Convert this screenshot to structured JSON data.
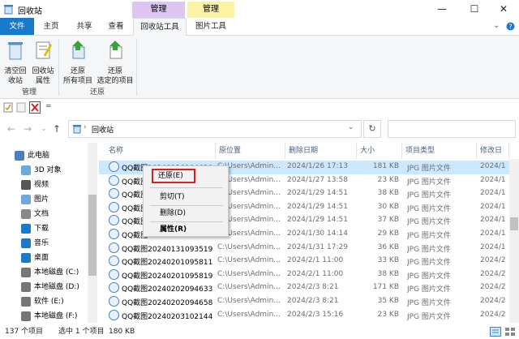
{
  "window": {
    "title": "回收站",
    "minimize": "—",
    "maximize": "☐",
    "close": "✕"
  },
  "contextual_tabs": [
    {
      "label": "管理",
      "color": "#ddc6f2"
    },
    {
      "label": "管理",
      "color": "#fdf3a4"
    }
  ],
  "tabs": {
    "file": "文件",
    "home": "主页",
    "share": "共享",
    "view": "查看",
    "recycle_tools": "回收站工具",
    "picture_tools": "图片工具"
  },
  "ribbon": {
    "empty_bin": [
      "清空回",
      "收站"
    ],
    "bin_props": [
      "回收站",
      "属性"
    ],
    "restore_all": [
      "还原",
      "所有项目"
    ],
    "restore_sel": [
      "还原",
      "选定的项目"
    ],
    "group_manage": "管理",
    "group_restore": "还原"
  },
  "address": {
    "path": "回收站",
    "dropdown": "⌄",
    "refresh": "↻"
  },
  "nav": {
    "back": "←",
    "forward": "→",
    "recent": "⌄",
    "up": "↑"
  },
  "navpane": [
    {
      "label": "此电脑",
      "icon": "computer-icon"
    },
    {
      "label": "3D 对象",
      "icon": "cube-icon"
    },
    {
      "label": "视频",
      "icon": "video-icon"
    },
    {
      "label": "图片",
      "icon": "picture-icon"
    },
    {
      "label": "文档",
      "icon": "document-icon"
    },
    {
      "label": "下载",
      "icon": "download-icon"
    },
    {
      "label": "音乐",
      "icon": "music-icon"
    },
    {
      "label": "桌面",
      "icon": "desktop-icon"
    },
    {
      "label": "本地磁盘 (C:)",
      "icon": "drive-icon"
    },
    {
      "label": "本地磁盘 (D:)",
      "icon": "drive-icon"
    },
    {
      "label": "软件 (E:)",
      "icon": "drive-icon"
    },
    {
      "label": "本地磁盘 (F:)",
      "icon": "drive-icon"
    }
  ],
  "columns": {
    "name": "名称",
    "path": "原位置",
    "deleted": "删除日期",
    "size": "大小",
    "type": "项目类型",
    "modified": "修改日"
  },
  "rows": [
    {
      "name": "QQ截图20240126104630",
      "path": "C:\\Users\\Admin...",
      "date": "2024/1/26 17:13",
      "size": "181 KB",
      "type": "JPG 图片文件",
      "mod": "2024/1"
    },
    {
      "name": "QQ截图",
      "path": "C:\\Users\\Admin...",
      "date": "2024/1/27 13:58",
      "size": "23 KB",
      "type": "JPG 图片文件",
      "mod": "2024/1"
    },
    {
      "name": "QQ截图",
      "path": "C:\\Users\\Admin...",
      "date": "2024/1/29 14:51",
      "size": "38 KB",
      "type": "JPG 图片文件",
      "mod": "2024/1"
    },
    {
      "name": "QQ截图",
      "path": "C:\\Users\\Admin...",
      "date": "2024/1/29 14:51",
      "size": "30 KB",
      "type": "JPG 图片文件",
      "mod": "2024/1"
    },
    {
      "name": "QQ截图",
      "path": "C:\\Users\\Admin...",
      "date": "2024/1/29 14:51",
      "size": "37 KB",
      "type": "JPG 图片文件",
      "mod": "2024/1"
    },
    {
      "name": "QQ截图",
      "path": "C:\\Users\\Admin...",
      "date": "2024/1/30 14:14",
      "size": "29 KB",
      "type": "JPG 图片文件",
      "mod": "2024/1"
    },
    {
      "name": "QQ截图20240131093519",
      "path": "C:\\Users\\Admin...",
      "date": "2024/1/31 17:29",
      "size": "36 KB",
      "type": "JPG 图片文件",
      "mod": "2024/1"
    },
    {
      "name": "QQ截图20240201095811",
      "path": "C:\\Users\\Admin...",
      "date": "2024/2/1 11:00",
      "size": "33 KB",
      "type": "JPG 图片文件",
      "mod": "2024/2"
    },
    {
      "name": "QQ截图20240201095819",
      "path": "C:\\Users\\Admin...",
      "date": "2024/2/1 11:00",
      "size": "38 KB",
      "type": "JPG 图片文件",
      "mod": "2024/2"
    },
    {
      "name": "QQ截图20240202094633",
      "path": "C:\\Users\\Admin...",
      "date": "2024/2/3 8:21",
      "size": "171 KB",
      "type": "JPG 图片文件",
      "mod": "2024/2"
    },
    {
      "name": "QQ截图20240202094658",
      "path": "C:\\Users\\Admin...",
      "date": "2024/2/3 8:21",
      "size": "35 KB",
      "type": "JPG 图片文件",
      "mod": "2024/2"
    },
    {
      "name": "QQ截图20240203102144",
      "path": "C:\\Users\\Admin...",
      "date": "2024/2/3 15:16",
      "size": "23 KB",
      "type": "JPG 图片文件",
      "mod": "2024/2"
    }
  ],
  "context_menu": {
    "restore": "还原(E)",
    "cut": "剪切(T)",
    "delete": "删除(D)",
    "properties": "属性(R)"
  },
  "status": {
    "count": "137 个项目",
    "selected": "选中 1 个项目",
    "size": "180 KB"
  },
  "colors": {
    "file_tab": "#1979ca",
    "selection": "#cce8ff",
    "highlight_border": "#d92020"
  }
}
